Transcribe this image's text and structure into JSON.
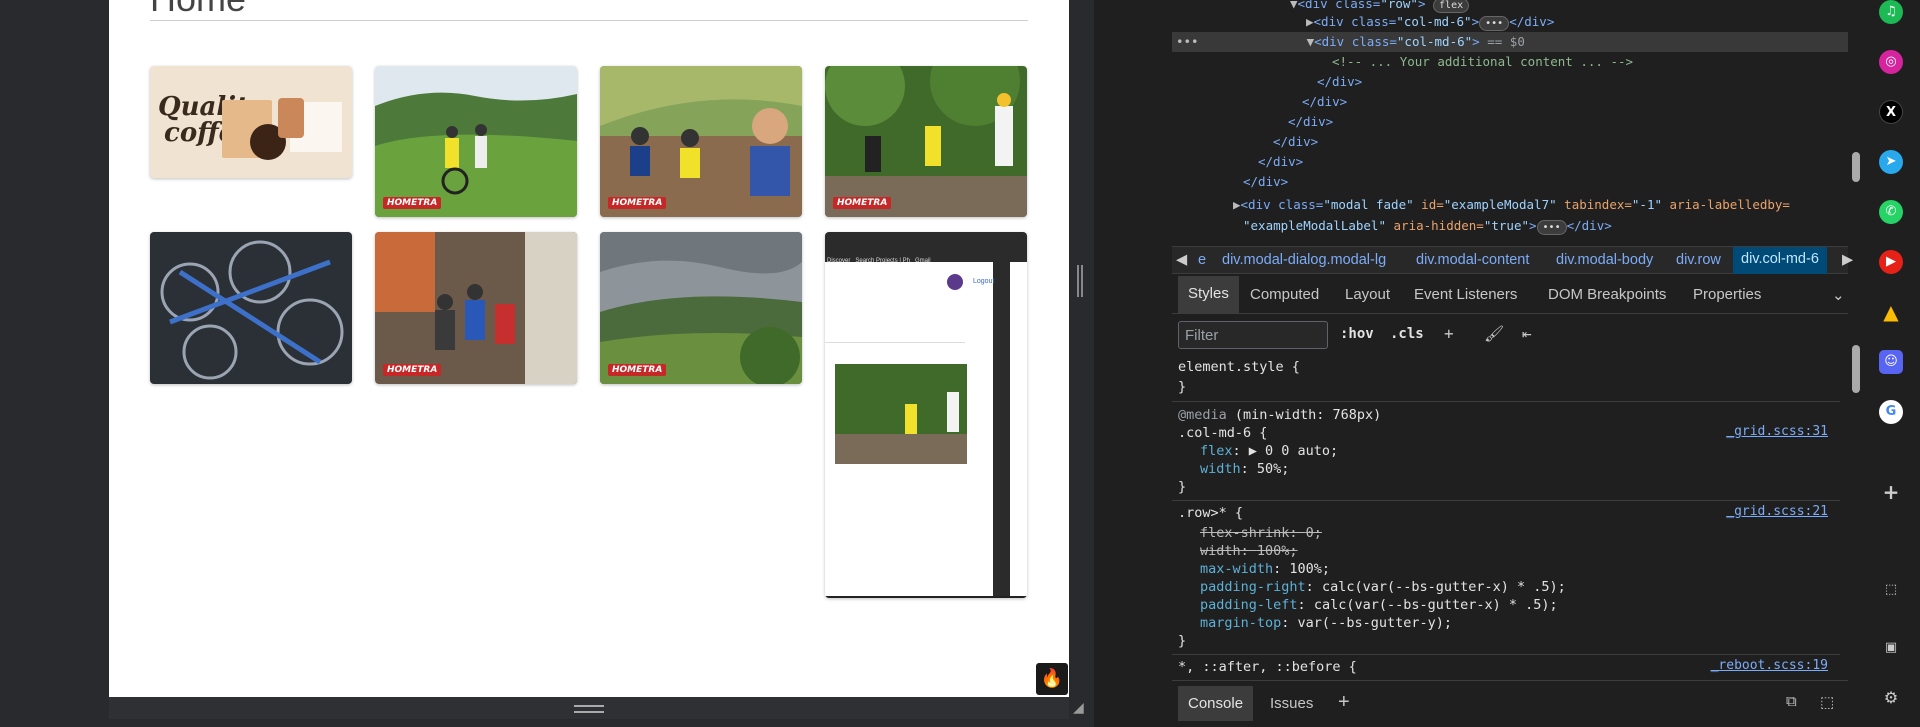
{
  "page": {
    "title": "Home",
    "watermark": "HOMETRA",
    "thumbnails": [
      {
        "name": "quality-coffee",
        "headline": "Quality",
        "subline": "coffee"
      },
      {
        "name": "cyclists-valley"
      },
      {
        "name": "cyclists-group-selfie"
      },
      {
        "name": "cyclists-under-trees"
      },
      {
        "name": "bike-pile"
      },
      {
        "name": "cyclists-gathering"
      },
      {
        "name": "mountain-landscape"
      },
      {
        "name": "nested-browser-screenshot",
        "tab_label": "Discover",
        "tab2_label": "Search Projects | Ph",
        "tab3_label": "Gmail",
        "logout_label": "Logout"
      }
    ]
  },
  "devtools": {
    "dom_lines": [
      {
        "indent": 7,
        "triangle": "▼",
        "tag": "<div class=",
        "val": "\"row\"",
        "tail": ">",
        "pill": "flex"
      },
      {
        "indent": 8,
        "triangle": "▶",
        "tag": "<div class=",
        "val": "\"col-md-6\"",
        "tail": ">",
        "pill": "•••",
        "close": "</div>"
      },
      {
        "indent": 8,
        "triangle": "▼",
        "tag": "<div class=",
        "val": "\"col-md-6\"",
        "tail": ">",
        "marker": " == $0"
      },
      {
        "indent": 10,
        "comment": "<!-- ... Your additional content ... -->"
      },
      {
        "indent": 9,
        "close": "</div>"
      },
      {
        "indent": 8,
        "close": "</div>"
      },
      {
        "indent": 7,
        "close": "</div>"
      },
      {
        "indent": 6,
        "close": "</div>"
      },
      {
        "indent": 5,
        "close": "</div>"
      },
      {
        "indent": 4,
        "close": "</div>"
      },
      {
        "indent": 4,
        "triangle": "▶",
        "tag": "<div class=",
        "val": "\"modal fade\"",
        "rest": " id=\"exampleModal7\" tabindex=\"-1\" aria-labelledby="
      },
      {
        "indent": 4,
        "plain": "\"exampleModalLabel\" aria-hidden=\"true\">",
        "pill": "•••",
        "close": "</div>"
      }
    ],
    "breadcrumbs": [
      "e",
      "div.modal-dialog.modal-lg",
      "div.modal-content",
      "div.modal-body",
      "div.row",
      "div.col-md-6"
    ],
    "panel_tabs": [
      "Styles",
      "Computed",
      "Layout",
      "Event Listeners",
      "DOM Breakpoints",
      "Properties"
    ],
    "filter_placeholder": "Filter",
    "hov_label": ":hov",
    "cls_label": ".cls",
    "rules": {
      "element_style": "element.style {",
      "close_brace": "}",
      "media": "@media",
      "media_query": "(min-width: 768px)",
      "col_selector": ".col-md-6 {",
      "col_link": "_grid.scss:31",
      "col_props": [
        {
          "name": "flex",
          "value": "▶ 0 0 auto;"
        },
        {
          "name": "width",
          "value": "50%;"
        }
      ],
      "row_selector": ".row>* {",
      "row_link": "_grid.scss:21",
      "row_props": [
        {
          "name": "flex-shrink",
          "value": "0;",
          "struck": true
        },
        {
          "name": "width",
          "value": "100%;",
          "struck": true
        },
        {
          "name": "max-width",
          "value": "100%;"
        },
        {
          "name": "padding-right",
          "value": "calc(var(--bs-gutter-x) * .5);"
        },
        {
          "name": "padding-left",
          "value": "calc(var(--bs-gutter-x) * .5);"
        },
        {
          "name": "margin-top",
          "value": "var(--bs-gutter-y);"
        }
      ],
      "universal_selector": "*, ::after, ::before {",
      "universal_link": "_reboot.scss:19"
    },
    "drawer_tabs": [
      "Console",
      "Issues"
    ]
  },
  "colors": {
    "accent": "#7cacf8",
    "selected_crumb": "#004a77"
  }
}
